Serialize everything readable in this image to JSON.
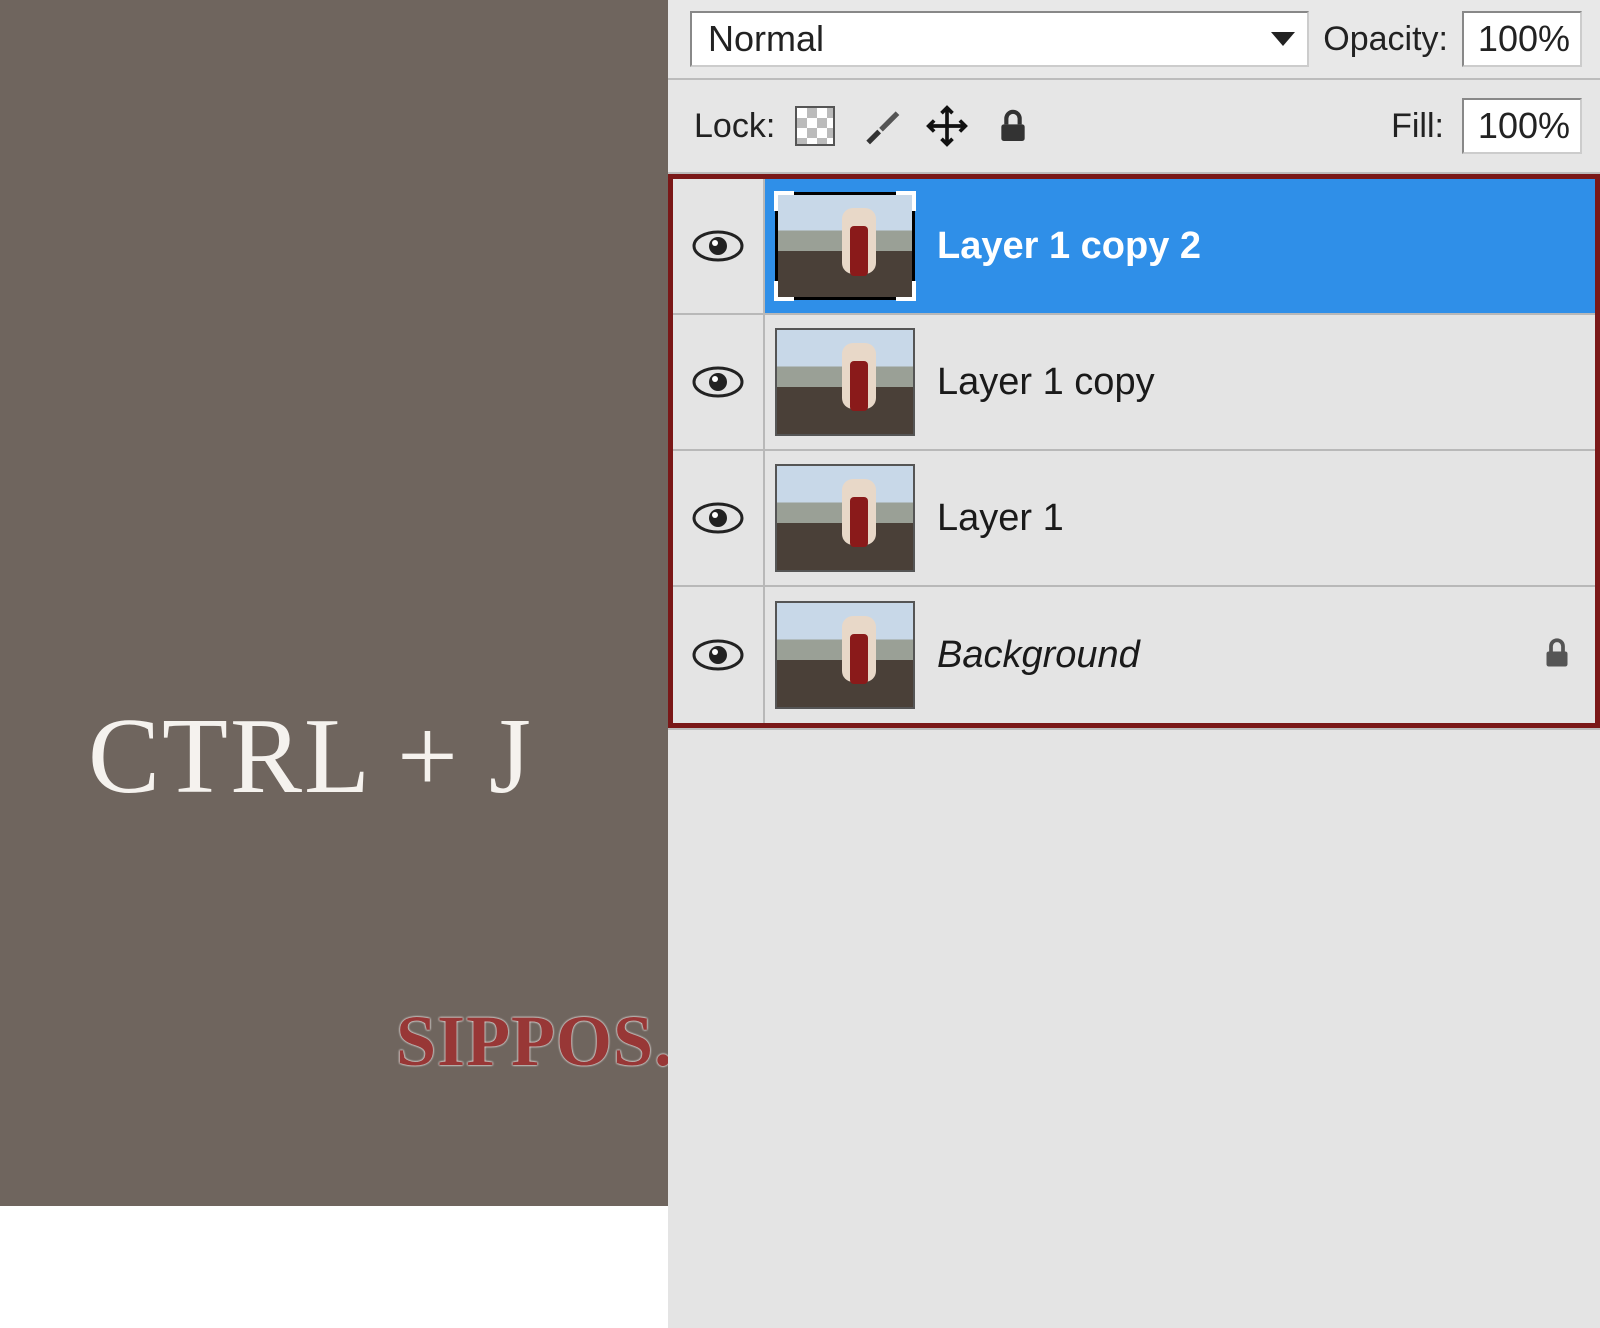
{
  "shortcut_label": "CTRL + J",
  "watermark": "SIPPOS.BLOGSPOT.COM",
  "panel": {
    "blend_mode": "Normal",
    "opacity_label": "Opacity:",
    "opacity_value": "100%",
    "lock_label": "Lock:",
    "fill_label": "Fill:",
    "fill_value": "100%"
  },
  "layers": [
    {
      "name": "Layer 1 copy 2",
      "selected": true,
      "visible": true,
      "locked": false,
      "italic": false
    },
    {
      "name": "Layer 1 copy",
      "selected": false,
      "visible": true,
      "locked": false,
      "italic": false
    },
    {
      "name": "Layer 1",
      "selected": false,
      "visible": true,
      "locked": false,
      "italic": false
    },
    {
      "name": "Background",
      "selected": false,
      "visible": true,
      "locked": true,
      "italic": true
    }
  ]
}
